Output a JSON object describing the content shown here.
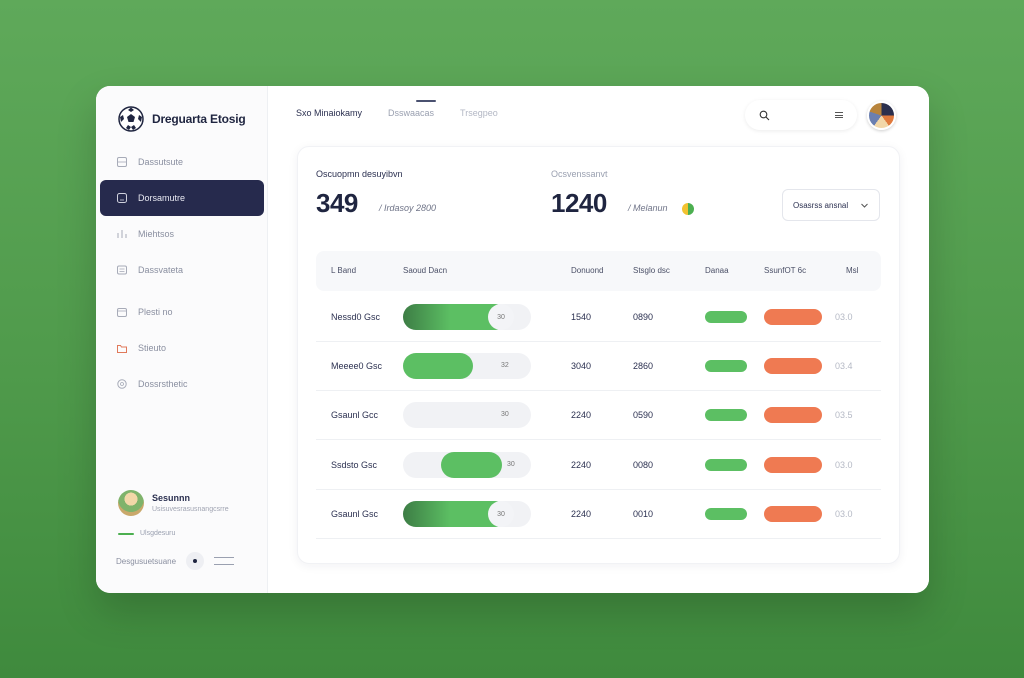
{
  "brand": {
    "name": "Dreguarta Etosig"
  },
  "sidebar": {
    "items": [
      {
        "label": "Dassutsute",
        "icon": "grid-icon"
      },
      {
        "label": "Dorsamutre",
        "icon": "square-icon"
      },
      {
        "label": "Miehtsos",
        "icon": "chart-icon"
      },
      {
        "label": "Dassvateta",
        "icon": "list-icon"
      },
      {
        "label": "Plesti no",
        "icon": "calendar-icon"
      },
      {
        "label": "Stieuto",
        "icon": "folder-icon"
      },
      {
        "label": "Dossrsthetic",
        "icon": "settings-icon"
      }
    ],
    "profile": {
      "name": "Sesunnn",
      "sub": "Usisuvesrasusnangcsrre"
    },
    "upgrade": "Ulsgdesuru",
    "footer": "Desgusuetsuane"
  },
  "topbar": {
    "tabs": [
      "Sxo Minaiokamy",
      "Dsswaacas",
      "Trsegpeo"
    ]
  },
  "stats": {
    "left": {
      "label": "Oscuopmn desuyibvn",
      "value": "349",
      "sub": "/ Irdasoy 2800"
    },
    "right": {
      "label": "Ocsvenssanvt",
      "value": "1240",
      "sub": "/ Melanun"
    }
  },
  "select": {
    "value": "Osasrss ansnal"
  },
  "table": {
    "headers": [
      "L Band",
      "Saoud Dacn",
      "Donuond",
      "Stsglo dsc",
      "Danaa",
      "SsunfOT 6c",
      "Msl"
    ],
    "rows": [
      {
        "name": "Nessd0 Gsc",
        "progress": 0.82,
        "start": 0.0,
        "pill_num": "30",
        "a": "1540",
        "b": "0890",
        "c": "03.0"
      },
      {
        "name": "Meeee0 Gsc",
        "progress": 0.55,
        "start": 0.0,
        "pill_num": "32",
        "a": "3040",
        "b": "2860",
        "c": "03.4"
      },
      {
        "name": "Gsaunl Gcc",
        "progress": 0.0,
        "start": 0.0,
        "pill_num": "30",
        "a": "2240",
        "b": "0590",
        "c": "03.5"
      },
      {
        "name": "Ssdsto Gsc",
        "progress": 0.48,
        "start": 0.3,
        "pill_num": "30",
        "a": "2240",
        "b": "0080",
        "c": "03.0"
      },
      {
        "name": "Gsaunl Gsc",
        "progress": 0.82,
        "start": 0.0,
        "pill_num": "30",
        "a": "2240",
        "b": "0010",
        "c": "03.0"
      }
    ]
  },
  "colors": {
    "accent_dark": "#262a4d",
    "green": "#5cbf63",
    "green_dark": "#3d7d45",
    "orange": "#ef7a52"
  }
}
